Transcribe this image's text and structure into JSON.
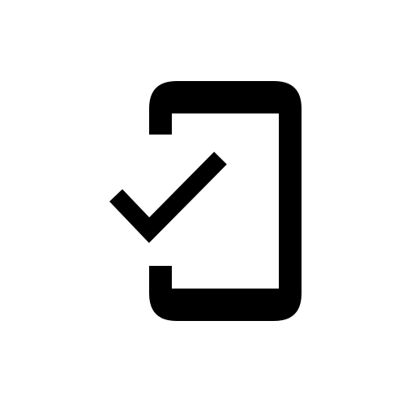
{
  "icon": {
    "name": "mobile-check-icon",
    "color": "#000000",
    "background": "#ffffff"
  }
}
